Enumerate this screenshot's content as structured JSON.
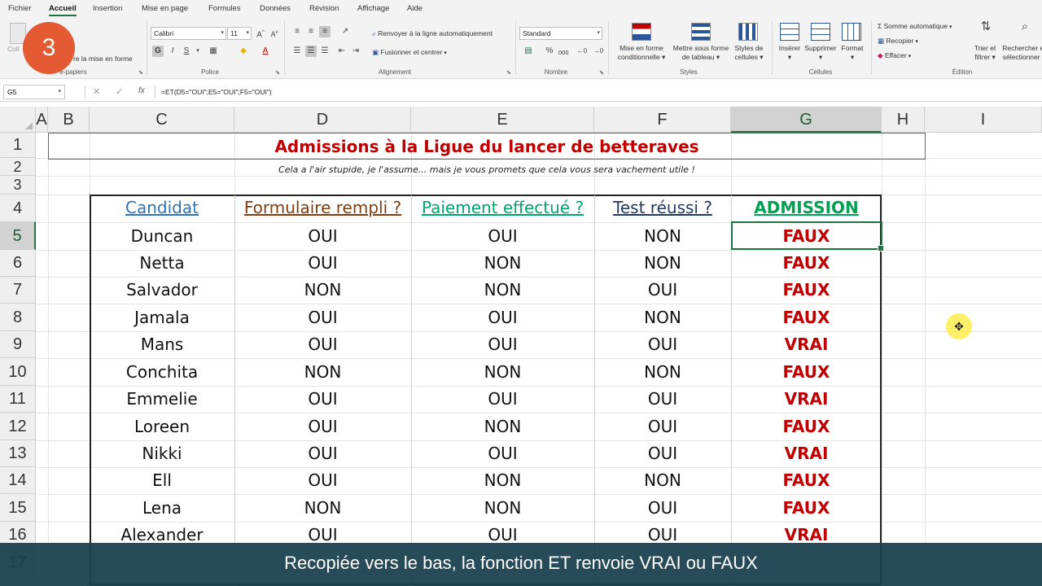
{
  "menu": [
    "Fichier",
    "Accueil",
    "Insertion",
    "Mise en page",
    "Formules",
    "Données",
    "Révision",
    "Affichage",
    "Aide"
  ],
  "ribbon": {
    "clipboard": {
      "label": "Presse-papiers",
      "paste": "Coller",
      "copy_format": "Reproduire la mise en forme",
      "label_visible": "e-papiers",
      "copy_visible": "re la mise en forme",
      "paste_visible": "Coll"
    },
    "font": {
      "label": "Police",
      "name": "Calibri",
      "size": "11",
      "bold": "G",
      "italic": "I",
      "underline": "S"
    },
    "alignment": {
      "label": "Alignement",
      "wrap": "Renvoyer à la ligne automatiquement",
      "merge": "Fusionner et centrer"
    },
    "number": {
      "label": "Nombre",
      "format": "Standard",
      "percent": "%",
      "thousands": "000"
    },
    "styles": {
      "label": "Styles",
      "cond": [
        "Mise en forme",
        "conditionnelle"
      ],
      "table": [
        "Mettre sous forme",
        "de tableau"
      ],
      "cell": [
        "Styles de",
        "cellules"
      ]
    },
    "cells": {
      "label": "Cellules",
      "insert": "Insérer",
      "delete": "Supprimer",
      "format": "Format"
    },
    "edit": {
      "label": "Édition",
      "autosum": "Somme automatique",
      "fill": "Recopier",
      "clear": "Effacer",
      "sort": [
        "Trier et",
        "filtrer"
      ],
      "find": [
        "Rechercher et",
        "sélectionner"
      ]
    }
  },
  "step_badge": "3",
  "formula_bar": {
    "cell_ref": "G5",
    "cancel": "✕",
    "confirm": "✓",
    "fx": "fx",
    "formula": "=ET(D5=\"OUI\";E5=\"OUI\";F5=\"OUI\")"
  },
  "columns": [
    "A",
    "B",
    "C",
    "D",
    "E",
    "F",
    "G",
    "H",
    "I"
  ],
  "rows": [
    "1",
    "2",
    "3",
    "4",
    "5",
    "6",
    "7",
    "8",
    "9",
    "10",
    "11",
    "12",
    "13",
    "14",
    "15",
    "16",
    "17"
  ],
  "sheet": {
    "title": "Admissions à la Ligue du lancer de betteraves",
    "subtitle": "Cela a l'air stupide, je l'assume... mais je vous promets que cela vous sera vachement utile !",
    "headers": [
      {
        "text": "Candidat",
        "color": "#2e75b6"
      },
      {
        "text": "Formulaire rempli ?",
        "color": "#843c0c"
      },
      {
        "text": "Paiement effectué ?",
        "color": "#00a86b"
      },
      {
        "text": "Test réussi ?",
        "color": "#1f3864"
      },
      {
        "text": "ADMISSION",
        "color": "#00a152"
      }
    ],
    "data": [
      [
        "Duncan",
        "OUI",
        "OUI",
        "NON",
        "FAUX"
      ],
      [
        "Netta",
        "OUI",
        "NON",
        "NON",
        "FAUX"
      ],
      [
        "Salvador",
        "NON",
        "NON",
        "OUI",
        "FAUX"
      ],
      [
        "Jamala",
        "OUI",
        "OUI",
        "NON",
        "FAUX"
      ],
      [
        "Mans",
        "OUI",
        "OUI",
        "OUI",
        "VRAI"
      ],
      [
        "Conchita",
        "NON",
        "NON",
        "NON",
        "FAUX"
      ],
      [
        "Emmelie",
        "OUI",
        "OUI",
        "OUI",
        "VRAI"
      ],
      [
        "Loreen",
        "OUI",
        "NON",
        "OUI",
        "FAUX"
      ],
      [
        "Nikki",
        "OUI",
        "OUI",
        "OUI",
        "VRAI"
      ],
      [
        "Ell",
        "OUI",
        "NON",
        "NON",
        "FAUX"
      ],
      [
        "Lena",
        "NON",
        "NON",
        "OUI",
        "FAUX"
      ],
      [
        "Alexander",
        "OUI",
        "OUI",
        "OUI",
        "VRAI"
      ]
    ]
  },
  "caption": "Recopiée vers le bas, la fonction ET renvoie VRAI ou FAUX",
  "colors": {
    "accent": "#217346",
    "title": "#c00000",
    "admission_value": "#c00000",
    "badge": "#e45a32",
    "caption_bg": "#19404e"
  }
}
